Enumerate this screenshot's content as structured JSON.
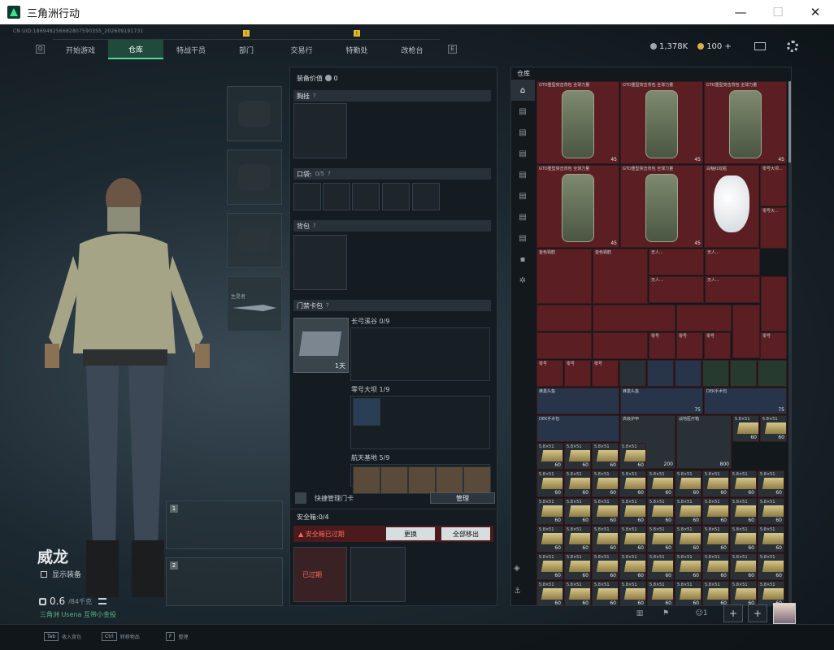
{
  "window": {
    "title": "三角洲行动",
    "min": "—",
    "max": "☐",
    "close": "✕"
  },
  "uid": "CN UID:1869482566828075903S5_202609191731",
  "nav": {
    "left_key": "Q",
    "right_key": "E",
    "tabs": [
      {
        "label": "开始游戏"
      },
      {
        "label": "仓库",
        "active": true
      },
      {
        "label": "特战干员"
      },
      {
        "label": "部门",
        "badge": "!"
      },
      {
        "label": "交易行"
      },
      {
        "label": "特勤处",
        "badge": "!"
      },
      {
        "label": "改枪台"
      }
    ]
  },
  "currency": {
    "silver": "1,378K",
    "gold": "100",
    "plus": "+"
  },
  "character": {
    "name": "威龙",
    "show_gear": "显示装备",
    "weight": "0.6",
    "weight_max": "/84千克",
    "green_hint": "三角洲 Usena 互带小金投"
  },
  "melee": {
    "label": "生是者"
  },
  "weapon_slots": [
    "1",
    "2"
  ],
  "middle": {
    "value_label": "装备价值",
    "value": "0",
    "chest": "胸挂",
    "pocket": "口袋:",
    "pocket_count": "0/5",
    "backpack": "背包",
    "keycard_bag": "门禁卡包",
    "keycard_timer": "1天",
    "grids": [
      {
        "label": "长弓溪谷 0/9"
      },
      {
        "label": "零号大坝 1/9"
      },
      {
        "label": "航天基地 5/9"
      }
    ],
    "quick_manage": "快捷管理门卡",
    "manage_btn": "管理",
    "help": "?"
  },
  "safe": {
    "label": "安全箱:",
    "count": "0/4",
    "expired_warn": "安全箱已过期",
    "replace_btn": "更换",
    "remove_btn": "全部移出",
    "expired_tag": "已过期"
  },
  "warehouse": {
    "title": "仓库",
    "bags": [
      {
        "name": "GTO重型突击背包 全球力量",
        "qty": "45"
      },
      {
        "name": "GTO重型突击背包 全球力量",
        "qty": "45"
      },
      {
        "name": "GTO重型突击背包 全球力量",
        "qty": "45"
      },
      {
        "name": "GTO重型突击背包 全球力量",
        "qty": "45"
      },
      {
        "name": "GTO重型突击背包 全球力量",
        "qty": "45"
      }
    ],
    "vase": {
      "name": "白釉红纹瓶"
    },
    "papers": [
      {
        "name": "零号大坝..."
      },
      {
        "name": "零号大..."
      }
    ],
    "mid_items": [
      "金色铜鹤",
      "金色铜鹤",
      "无人...",
      "无人...",
      "无人...",
      "无人..."
    ],
    "cards": [
      "零号",
      "零号",
      "零号",
      "零号",
      "零号",
      "零号",
      "零号",
      "零号"
    ],
    "med": [
      {
        "name": "高级护甲",
        "qty": "200"
      },
      {
        "name": "战地医疗箱",
        "qty": "800"
      }
    ],
    "cases": [
      {
        "name": "蜂巢头盔",
        "qty": ""
      },
      {
        "name": "蜂巢头盔",
        "qty": "75"
      },
      {
        "name": "DEK手术包",
        "qty": "75"
      },
      {
        "name": "DEK手术包",
        "qty": ""
      }
    ],
    "ammo_label": "5.8×51",
    "ammo_qty": "60"
  },
  "bottom": {
    "hints": [
      {
        "key": "Tab",
        "text": "收入背包"
      },
      {
        "key": "Ctrl",
        "text": "转移物品"
      },
      {
        "key": "F",
        "text": "整理"
      }
    ],
    "badge": "!",
    "friends": "1",
    "plus": "+"
  }
}
